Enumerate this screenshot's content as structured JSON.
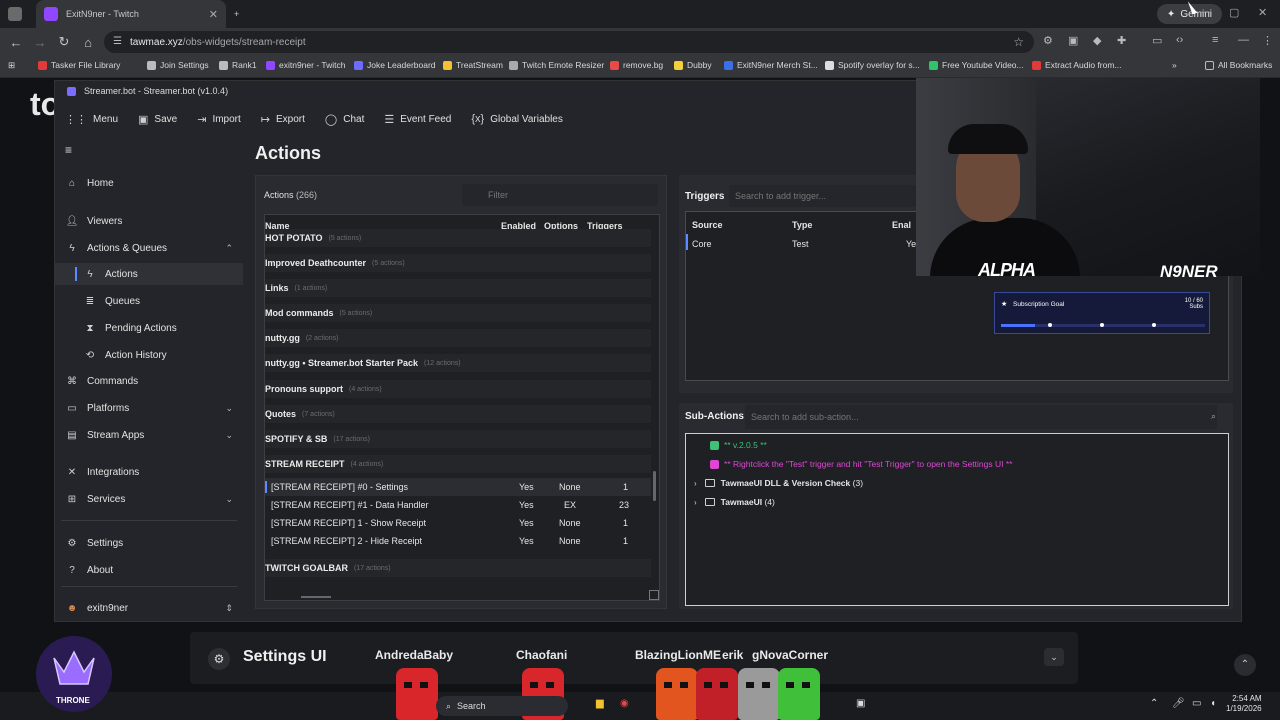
{
  "browser": {
    "tabs": [
      {
        "label": "",
        "active": false
      },
      {
        "label": "ExitN9ner - Twitch",
        "active": true
      }
    ],
    "new_tab": "+",
    "gemini_label": "Gemini",
    "url_host": "tawmae.xyz",
    "url_path": "/obs-widgets/stream-receipt",
    "bookmarks": [
      "Tasker File Library",
      "Join Settings",
      "Rank1",
      "exitn9ner - Twitch",
      "Joke Leaderboard",
      "TreatStream",
      "Twitch Emote Resizer",
      "remove.bg",
      "Dubby",
      "ExitN9ner Merch St...",
      "Spotify overlay for s...",
      "Free Youtube Video...",
      "Extract Audio from...",
      "All Bookmarks"
    ]
  },
  "page": {
    "bg_logo": "to"
  },
  "streamerbot": {
    "title": "Streamer.bot - Streamer.bot (v1.0.4)",
    "toolbar": {
      "menu": "Menu",
      "save": "Save",
      "import": "Import",
      "export": "Export",
      "chat": "Chat",
      "event_feed": "Event Feed",
      "global_variables": "Global Variables"
    },
    "sidebar": {
      "home": "Home",
      "viewers": "Viewers",
      "actions_queues": "Actions & Queues",
      "actions": "Actions",
      "queues": "Queues",
      "pending_actions": "Pending Actions",
      "action_history": "Action History",
      "commands": "Commands",
      "platforms": "Platforms",
      "stream_apps": "Stream Apps",
      "integrations": "Integrations",
      "services": "Services",
      "settings": "Settings",
      "about": "About",
      "user": "exitn9ner"
    },
    "page_title": "Actions",
    "actions_panel": {
      "label": "Actions",
      "count": "(266)",
      "filter_placeholder": "Filter",
      "columns": {
        "name": "Name",
        "enabled": "Enabled",
        "options": "Options",
        "triggers": "Triggers"
      },
      "groups": [
        {
          "name": "HOT POTATO",
          "count": "(5 actions)"
        },
        {
          "name": "Improved Deathcounter",
          "count": "(5 actions)"
        },
        {
          "name": "Links",
          "count": "(1 actions)"
        },
        {
          "name": "Mod commands",
          "count": "(5 actions)"
        },
        {
          "name": "nutty.gg",
          "count": "(2 actions)"
        },
        {
          "name": "nutty.gg • Streamer.bot Starter Pack",
          "count": "(12 actions)"
        },
        {
          "name": "Pronouns support",
          "count": "(4 actions)"
        },
        {
          "name": "Quotes",
          "count": "(7 actions)"
        },
        {
          "name": "SPOTIFY & SB",
          "count": "(17 actions)"
        },
        {
          "name": "STREAM RECEIPT",
          "count": "(4 actions)"
        }
      ],
      "rows": [
        {
          "name": "[STREAM RECEIPT] #0 - Settings",
          "enabled": "Yes",
          "options": "None",
          "triggers": "1"
        },
        {
          "name": "[STREAM RECEIPT] #1 - Data Handler",
          "enabled": "Yes",
          "options": "EX",
          "triggers": "23"
        },
        {
          "name": "[STREAM RECEIPT] 1 - Show Receipt",
          "enabled": "Yes",
          "options": "None",
          "triggers": "1"
        },
        {
          "name": "[STREAM RECEIPT] 2 - Hide Receipt",
          "enabled": "Yes",
          "options": "None",
          "triggers": "1"
        }
      ],
      "last_group": {
        "name": "TWITCH GOALBAR",
        "count": "(17 actions)"
      }
    },
    "triggers_panel": {
      "label": "Triggers",
      "search_placeholder": "Search to add trigger...",
      "columns": {
        "source": "Source",
        "type": "Type",
        "enabled": "Enal"
      },
      "rows": [
        {
          "source": "Core",
          "type": "Test",
          "enabled": "Ye"
        }
      ]
    },
    "subactions_panel": {
      "label": "Sub-Actions",
      "search_placeholder": "Search to add sub-action...",
      "items": [
        {
          "text": "** v.2.0.5 **",
          "color": "#3fbf7a"
        },
        {
          "text": "** Rightclick the \"Test\" trigger and hit \"Test Trigger\" to open the Settings UI **",
          "color": "#e046d6"
        },
        {
          "text": "TawmaeUI DLL & Version Check",
          "count": "(3)"
        },
        {
          "text": "TawmaeUI",
          "count": "(4)"
        }
      ]
    }
  },
  "overlay": {
    "cam_text_left": "ALPHA",
    "cam_text_right": "N9NER",
    "goal_title": "Subscription Goal",
    "goal_count": "10 / 60",
    "goal_unit": "Subs",
    "goal_progress": 0.167,
    "settings_title": "Settings UI",
    "chat_names": [
      "AndredaBaby",
      "Chaofani",
      "BlazingLionME",
      "erik",
      "gNovaCorner"
    ],
    "throne_label": "THRONE"
  },
  "taskbar": {
    "search": "Search",
    "time": "2:54 AM",
    "date": "1/19/2026"
  },
  "colors": {
    "accent": "#5b8cff",
    "twitch": "#9146ff",
    "sprite_red": "#d9262a",
    "sprite_green": "#3fbf3a"
  }
}
